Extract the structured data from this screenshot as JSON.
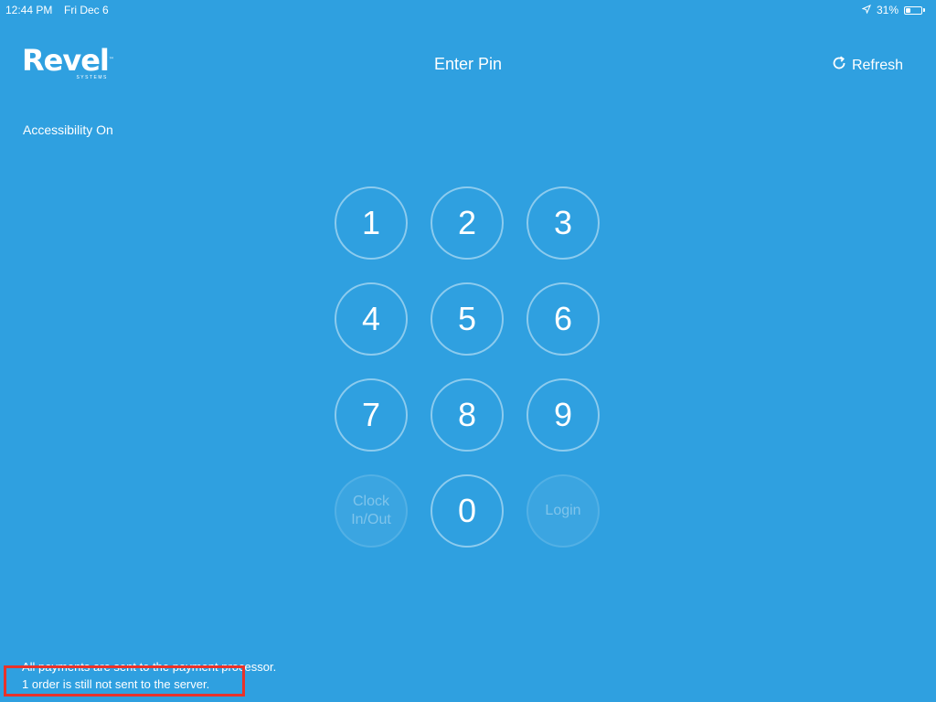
{
  "status_bar": {
    "time": "12:44 PM",
    "date": "Fri Dec 6",
    "battery_text": "31%",
    "battery_level": 0.31
  },
  "logo": {
    "text": "Revel",
    "tm": "™",
    "subtitle": "SYSTEMS"
  },
  "header": {
    "title": "Enter Pin",
    "refresh_label": "Refresh"
  },
  "accessibility_label": "Accessibility On",
  "keypad": {
    "keys": [
      "1",
      "2",
      "3",
      "4",
      "5",
      "6",
      "7",
      "8",
      "9"
    ],
    "clock_label_line1": "Clock",
    "clock_label_line2": "In/Out",
    "zero": "0",
    "login": "Login"
  },
  "footer": {
    "line1": "All payments are sent to the payment processor.",
    "line2": "1 order is still not sent to the server."
  },
  "colors": {
    "background": "#2fa0e0",
    "highlight": "#e8322a"
  }
}
